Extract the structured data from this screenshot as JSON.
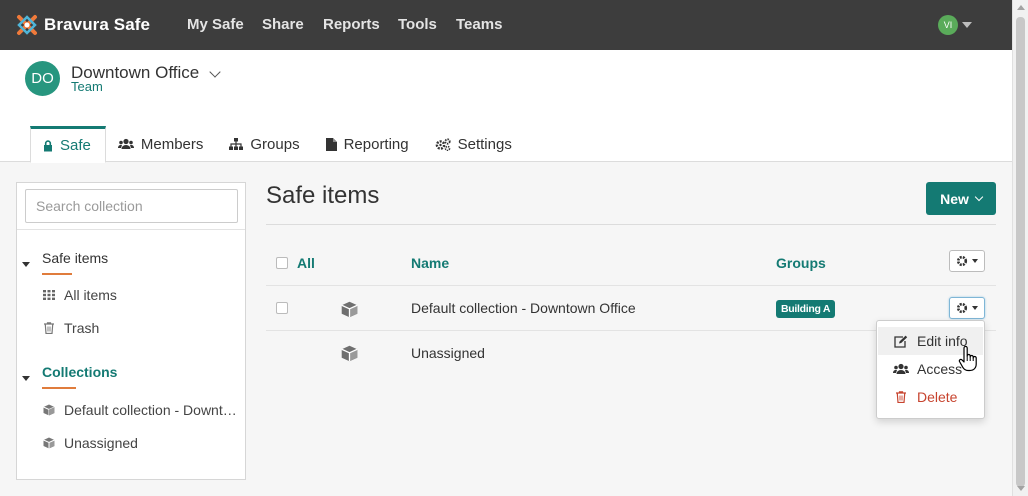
{
  "nav": {
    "brand": "Bravura Safe",
    "links": [
      "My Safe",
      "Share",
      "Reports",
      "Tools",
      "Teams"
    ],
    "user_initials": "VI"
  },
  "team": {
    "initials": "DO",
    "name": "Downtown Office",
    "type": "Team"
  },
  "tabs": [
    {
      "label": "Safe",
      "icon": "lock-icon"
    },
    {
      "label": "Members",
      "icon": "users-icon"
    },
    {
      "label": "Groups",
      "icon": "sitemap-icon"
    },
    {
      "label": "Reporting",
      "icon": "file-icon"
    },
    {
      "label": "Settings",
      "icon": "cogs-icon"
    }
  ],
  "sidebar": {
    "search_placeholder": "Search collection",
    "safe_items_heading": "Safe items",
    "safe_items": [
      {
        "label": "All items",
        "icon": "grid-icon"
      },
      {
        "label": "Trash",
        "icon": "trash-icon"
      }
    ],
    "collections_heading": "Collections",
    "collections": [
      {
        "label": "Default collection - Downt…",
        "icon": "cube-icon"
      },
      {
        "label": "Unassigned",
        "icon": "cube-icon"
      }
    ]
  },
  "main": {
    "title": "Safe items",
    "new_button": "New",
    "table": {
      "headers": {
        "all": "All",
        "name": "Name",
        "groups": "Groups"
      },
      "rows": [
        {
          "name": "Default collection - Downtown Office",
          "group": "Building A"
        },
        {
          "name": "Unassigned",
          "group": ""
        }
      ]
    }
  },
  "row_menu": {
    "items": [
      {
        "label": "Edit info",
        "icon": "edit-icon"
      },
      {
        "label": "Access",
        "icon": "users-icon"
      },
      {
        "label": "Delete",
        "icon": "trash-icon"
      }
    ]
  },
  "colors": {
    "accent": "#147a73",
    "nav_bg": "#3d3d3d",
    "danger": "#c7432e",
    "underline": "#e07c3c"
  }
}
